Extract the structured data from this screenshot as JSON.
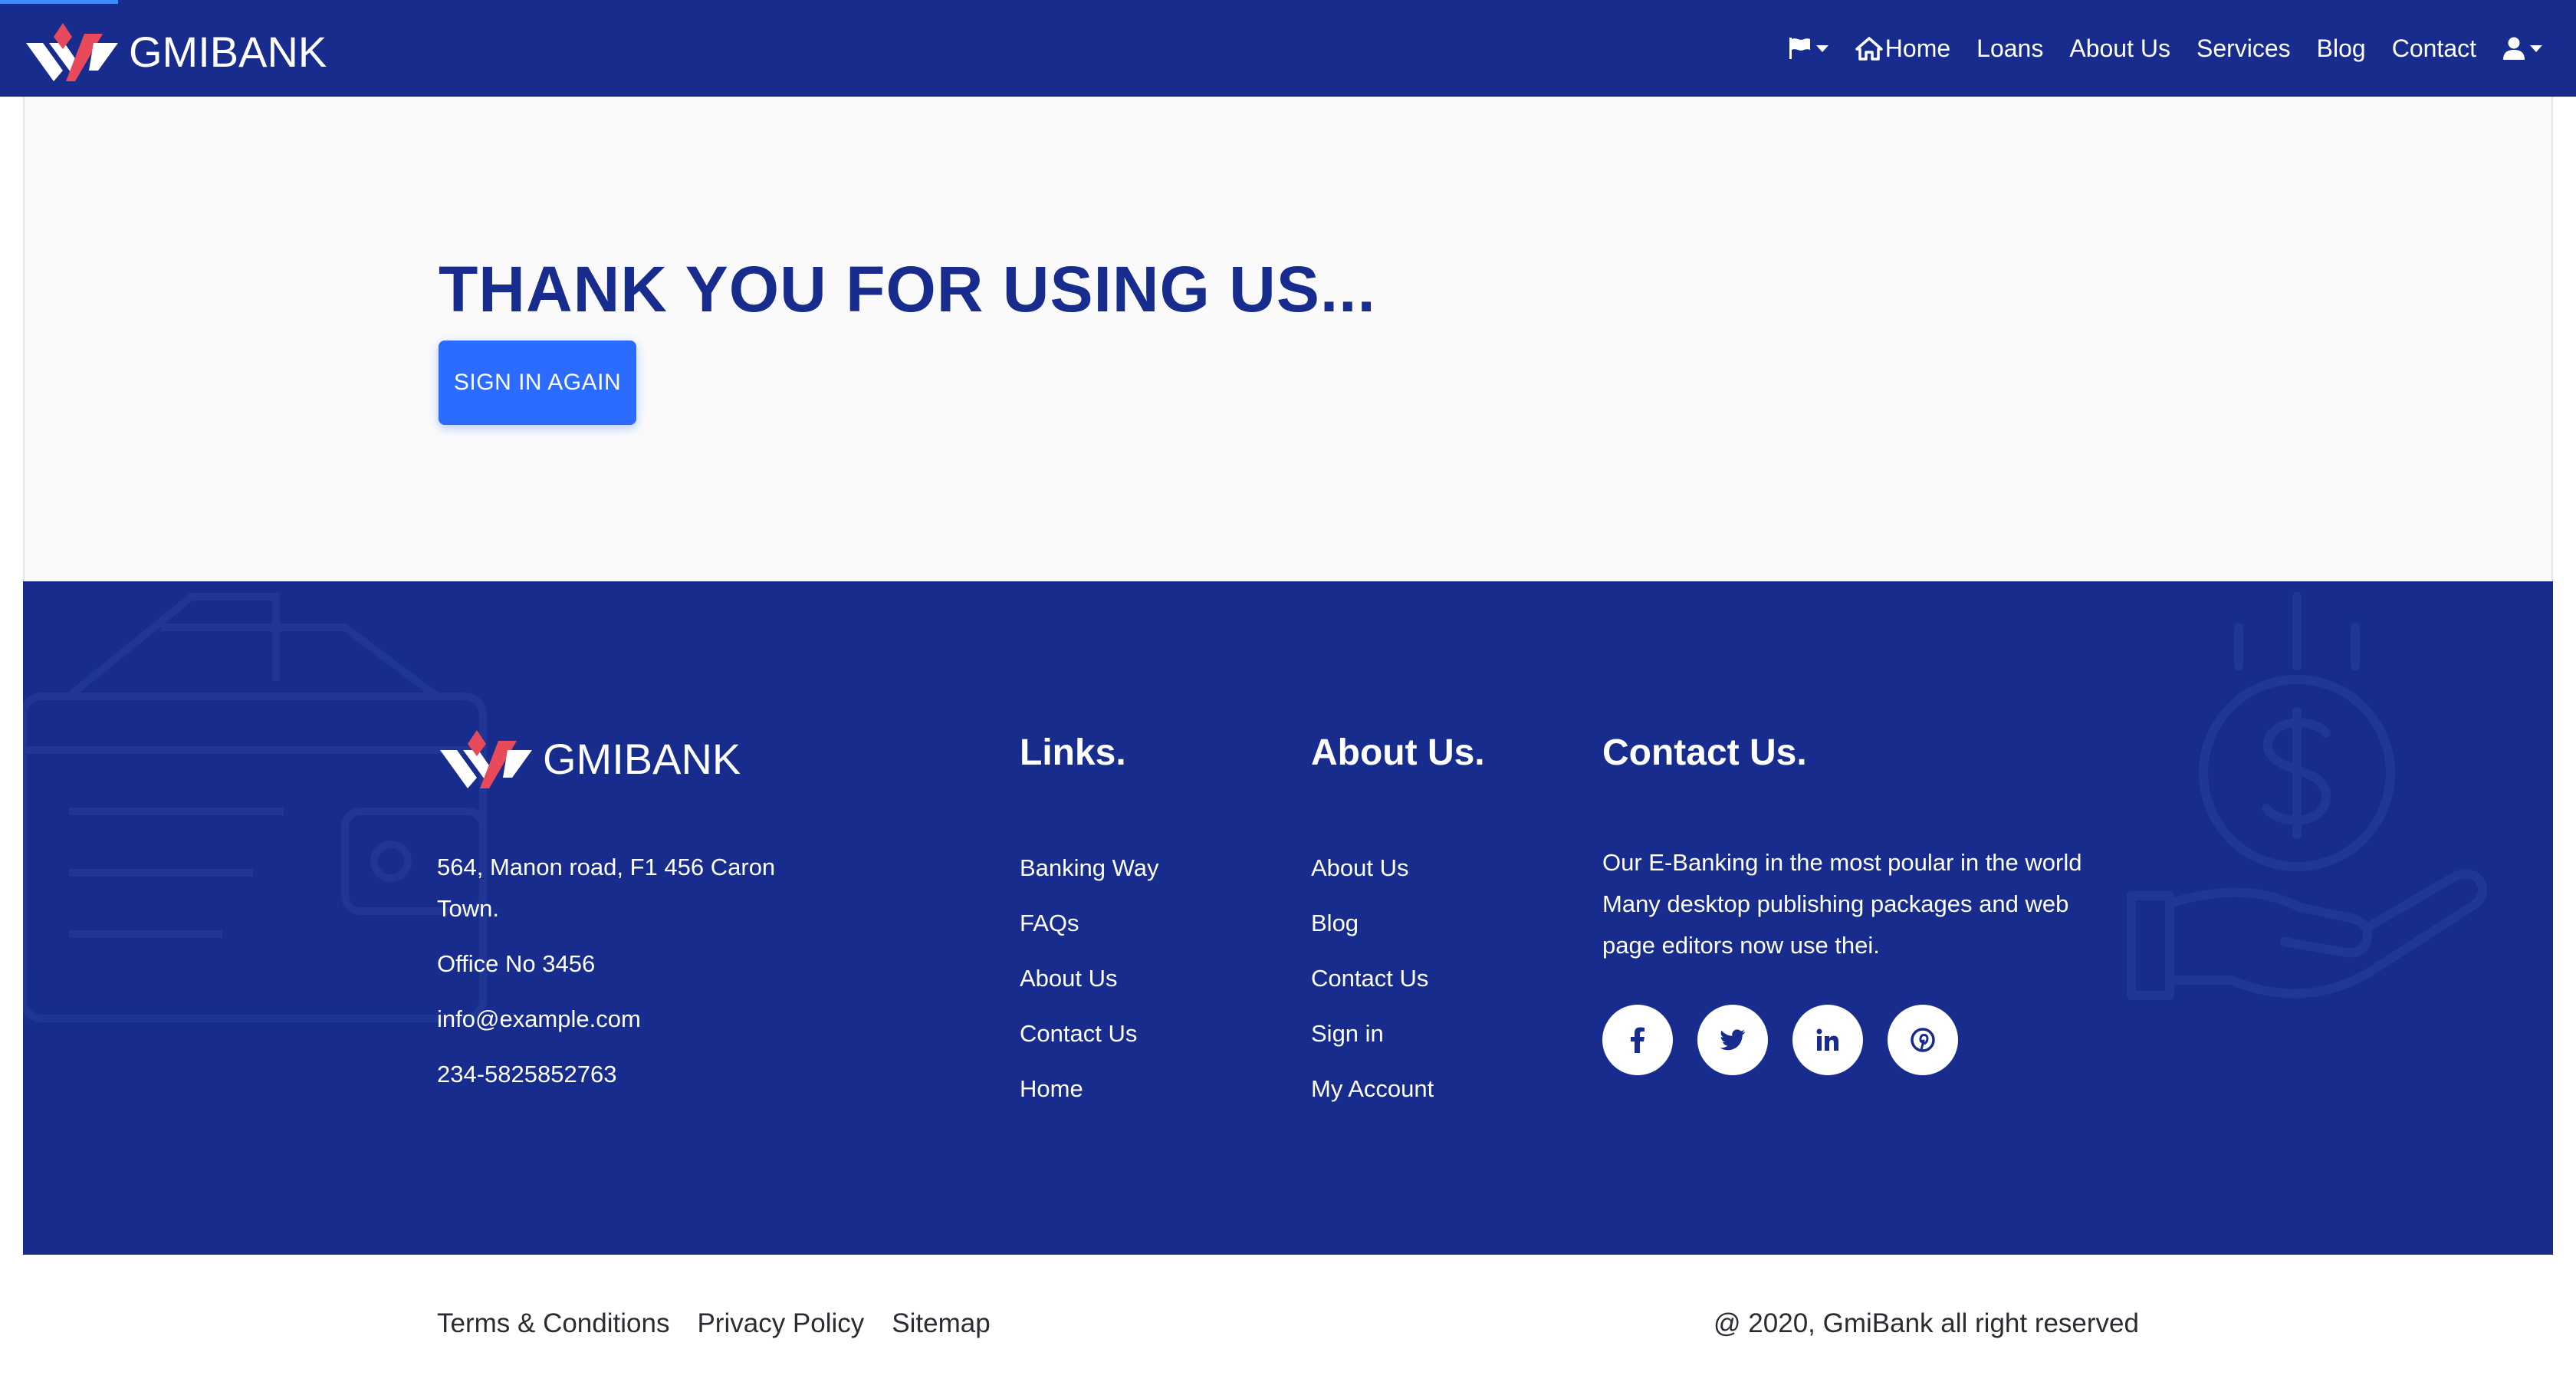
{
  "navbar": {
    "brand": "GMIBANK",
    "items": [
      {
        "label": "Home"
      },
      {
        "label": "Loans"
      },
      {
        "label": "About Us"
      },
      {
        "label": "Services"
      },
      {
        "label": "Blog"
      },
      {
        "label": "Contact"
      }
    ],
    "icons": [
      "flag-icon",
      "home-icon",
      "user-icon"
    ]
  },
  "hero": {
    "title": "THANK YOU FOR USING US...",
    "button_label": "SIGN IN AGAIN"
  },
  "footer": {
    "brand": "GMIBANK",
    "address_line1": "564, Manon road, F1 456 Caron",
    "address_line2": "Town.",
    "office": "Office No 3456",
    "email": "info@example.com",
    "phone": "234-5825852763",
    "links_heading": "Links.",
    "links": [
      "Banking Way",
      "FAQs",
      "About Us",
      "Contact Us",
      "Home"
    ],
    "about_heading": "About Us.",
    "about_links": [
      "About Us",
      "Blog",
      "Contact Us",
      "Sign in",
      "My Account"
    ],
    "contact_heading": "Contact Us.",
    "contact_line1": "Our E-Banking in the most poular in the world",
    "contact_line2": "Many desktop publishing packages and web",
    "contact_line3": "page editors now use thei.",
    "socials": [
      "facebook-icon",
      "twitter-icon",
      "linkedin-icon",
      "pinterest-icon"
    ]
  },
  "bottom": {
    "links": [
      "Terms & Conditions",
      "Privacy Policy",
      "Sitemap"
    ],
    "copyright": "@ 2020, GmiBank all right reserved"
  },
  "colors": {
    "navy": "#172c8c",
    "button_blue": "#2b6cff",
    "logo_red": "#e8495b",
    "hero_bg": "#fafafb"
  }
}
